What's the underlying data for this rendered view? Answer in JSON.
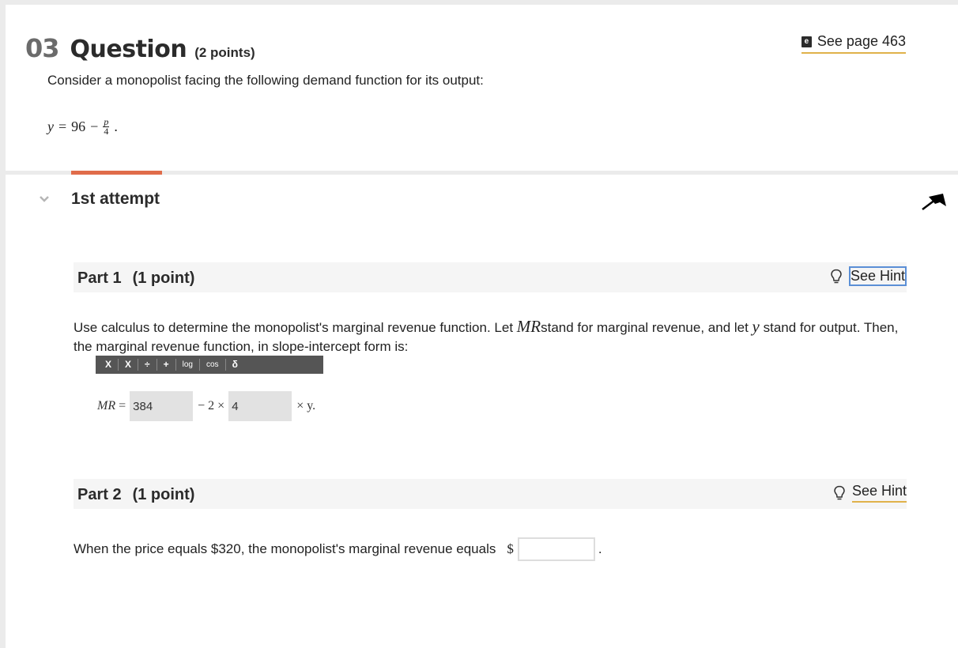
{
  "question": {
    "number": "03",
    "word": "Question",
    "points": "(2 points)",
    "ebook_link": "See page 463",
    "ebook_icon_glyph": "e",
    "prompt": "Consider a monopolist facing the following demand function for its output:",
    "equation": {
      "lhs": "y",
      "equals": "=",
      "constant": "96",
      "minus": "−",
      "numerator": "p",
      "denominator": "4",
      "end": "."
    }
  },
  "attempt": {
    "title": "1st attempt",
    "accent_color": "#e06c4a"
  },
  "part1": {
    "title": "Part 1",
    "points": "(1 point)",
    "hint": "See Hint",
    "text_a": "Use calculus to determine the monopolist's marginal revenue function. Let ",
    "var_mr": "MR",
    "text_b": "stand for marginal revenue, and let ",
    "var_y": "y",
    "text_c": " stand for output. Then, the marginal revenue function, in slope-intercept form is:",
    "toolbar": [
      "X",
      "X",
      "÷",
      "+",
      "log",
      "cos",
      "δ"
    ],
    "mr_label": "MR",
    "mr_equals": "=",
    "intercept_value": "384",
    "middle_op": "− 2 ×",
    "slope_value": "4",
    "tail": "× y."
  },
  "part2": {
    "title": "Part 2",
    "points": "(1 point)",
    "hint": "See Hint",
    "text": "When the price equals $320, the monopolist's marginal revenue equals",
    "currency": "$",
    "answer_value": "",
    "end": "."
  }
}
